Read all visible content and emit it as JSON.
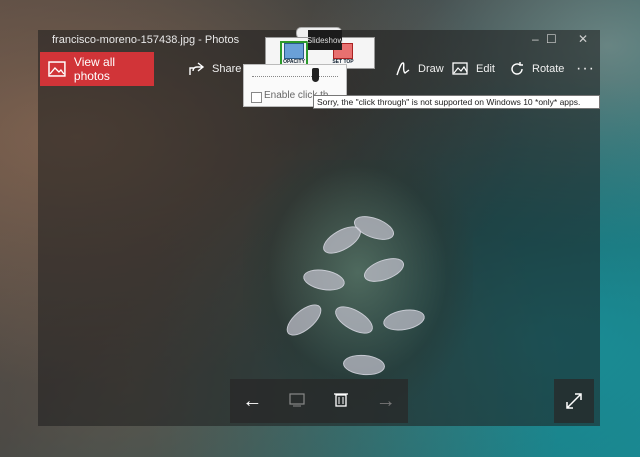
{
  "window": {
    "title": "francisco-moreno-157438.jpg - Photos"
  },
  "toolbar": {
    "view_all": "View all photos",
    "share": "Share",
    "slideshow": "Slideshow",
    "draw": "Draw",
    "edit": "Edit",
    "rotate": "Rotate",
    "more": "···"
  },
  "topmost_tool": {
    "opacity_label": "OPACITY",
    "settop_label": "SET TOP",
    "opacity_level": 0.8,
    "enable_click_through_label": "Enable click th",
    "tooltip": "Sorry, the \"click through\" is not supported on Windows 10 *only* apps."
  },
  "bottom_bar": {
    "previous": "←",
    "next": "→"
  },
  "icons": [
    "image-icon",
    "share-icon",
    "draw-icon",
    "edit-icon",
    "rotate-icon",
    "more-icon",
    "left-arrow-icon",
    "frame-icon",
    "trash-icon",
    "right-arrow-icon",
    "fullscreen-icon"
  ],
  "colors": {
    "accent": "#d13438",
    "opacity_border": "#2c9a2c"
  }
}
